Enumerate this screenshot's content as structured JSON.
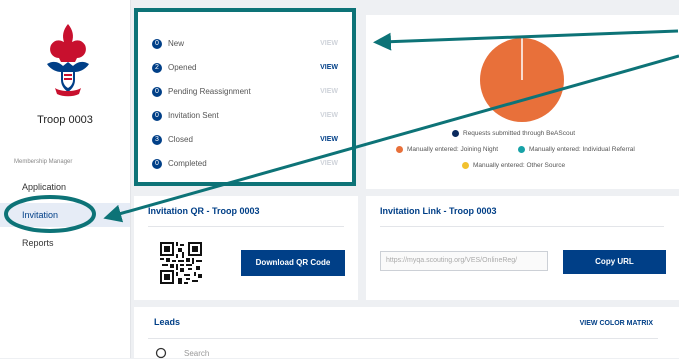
{
  "sidebar": {
    "troop_name": "Troop 0003",
    "section_label": "Membership Manager",
    "items": [
      {
        "label": "Application",
        "active": false
      },
      {
        "label": "Invitation",
        "active": true
      },
      {
        "label": "Reports",
        "active": false
      }
    ]
  },
  "status": {
    "rows": [
      {
        "count": "0",
        "label": "New",
        "view": "VIEW",
        "view_enabled": false
      },
      {
        "count": "2",
        "label": "Opened",
        "view": "VIEW",
        "view_enabled": true
      },
      {
        "count": "0",
        "label": "Pending Reassignment",
        "view": "VIEW",
        "view_enabled": false
      },
      {
        "count": "0",
        "label": "Invitation Sent",
        "view": "VIEW",
        "view_enabled": false
      },
      {
        "count": "3",
        "label": "Closed",
        "view": "VIEW",
        "view_enabled": true
      },
      {
        "count": "0",
        "label": "Completed",
        "view": "VIEW",
        "view_enabled": false
      }
    ]
  },
  "chart": {
    "legend": [
      {
        "label": "Requests submitted through BeAScout",
        "color": "#0a2a5e"
      },
      {
        "label": "Manually entered: Joining Night",
        "color": "#e8703a"
      },
      {
        "label": "Manually entered: Individual Referral",
        "color": "#17a2a7"
      },
      {
        "label": "Manually entered: Other Source",
        "color": "#f2c12e"
      }
    ]
  },
  "chart_data": {
    "type": "pie",
    "slices": [
      {
        "label": "Requests submitted through BeAScout",
        "value": 0
      },
      {
        "label": "Manually entered: Joining Night",
        "value": 100
      },
      {
        "label": "Manually entered: Individual Referral",
        "value": 0
      },
      {
        "label": "Manually entered: Other Source",
        "value": 0
      }
    ]
  },
  "qr_card": {
    "title": "Invitation QR - Troop 0003",
    "button": "Download QR Code"
  },
  "link_card": {
    "title": "Invitation Link - Troop 0003",
    "url": "https://myqa.scouting.org/VES/OnlineReg/",
    "button": "Copy URL"
  },
  "leads": {
    "title": "Leads",
    "color_matrix": "VIEW COLOR MATRIX",
    "search_placeholder": "Search"
  },
  "colors": {
    "brand": "#003f87",
    "highlight": "#0d7377",
    "pie": "#e8703a"
  }
}
